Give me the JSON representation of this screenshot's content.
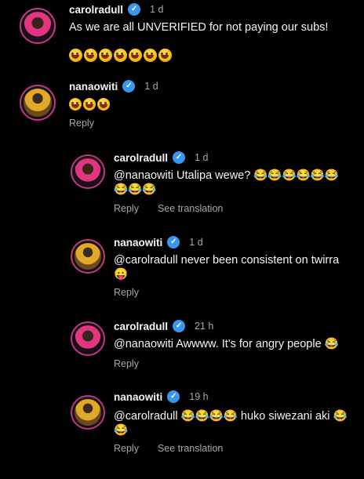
{
  "comments": [
    {
      "username": "carolradull",
      "time": "1 d",
      "text": "As we are all UNVERIFIED for not paying our subs!",
      "emoji_line": "🤣🤣🤣🤣🤣🤣",
      "avatar": "carol"
    },
    {
      "username": "nanaowiti",
      "time": "1 d",
      "text": "",
      "emoji_line": "😂😂😂",
      "reply_label": "Reply"
    }
  ],
  "replies": [
    {
      "username": "carolradull",
      "time": "1 d",
      "text": "@nanaowiti Utalipa wewe? 😂😂😂😂😂😂",
      "text2": "😂😂😂",
      "reply_label": "Reply",
      "translation_label": "See translation"
    },
    {
      "username": "nanaowiti",
      "time": "1 d",
      "text": "@carolradull never been consistent on twirra",
      "text2": "😛",
      "reply_label": "Reply"
    },
    {
      "username": "carolradull",
      "time": "21 h",
      "text": "@nanaowiti Awwww. It's for angry people 😂",
      "reply_label": "Reply"
    },
    {
      "username": "nanaowiti",
      "time": "19 h",
      "text": "@carolradull 😂😂😂😂 huko siwezani aki 😂",
      "text2": "😂",
      "reply_label": "Reply",
      "translation_label": "See translation"
    }
  ],
  "colors": {
    "background": "#000000",
    "text": "#f5f5f5",
    "muted": "#a8a8a8",
    "verified": "#3897f0",
    "story_ring": "#c13584"
  },
  "icons": {
    "verified": "verified-badge-icon"
  }
}
